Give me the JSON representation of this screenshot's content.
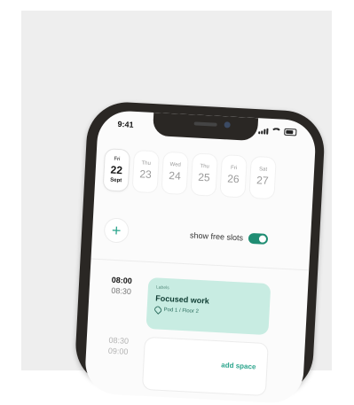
{
  "status": {
    "time": "9:41"
  },
  "days": [
    {
      "dow": "Fri",
      "num": "22",
      "mon": "Sept",
      "selected": true
    },
    {
      "dow": "Thu",
      "num": "23",
      "mon": "",
      "selected": false
    },
    {
      "dow": "Wed",
      "num": "24",
      "mon": "",
      "selected": false
    },
    {
      "dow": "Thu",
      "num": "25",
      "mon": "",
      "selected": false
    },
    {
      "dow": "Fri",
      "num": "26",
      "mon": "",
      "selected": false
    },
    {
      "dow": "Sat",
      "num": "27",
      "mon": "",
      "selected": false
    }
  ],
  "controls": {
    "add_symbol": "+",
    "free_slots_label": "show free slots",
    "free_slots_on": true
  },
  "slots": [
    {
      "start": "08:00",
      "end": "08:30",
      "active": true,
      "booking": {
        "tag": "Labels",
        "title": "Focused work",
        "place": "Pod 1 / Floor 2"
      }
    },
    {
      "start": "08:30",
      "end": "09:00",
      "active": false,
      "action": "add space"
    }
  ],
  "colors": {
    "accent": "#2ca58d",
    "booking_bg": "#c8ece2",
    "toggle": "#1f8d73",
    "phone": "#2a2724"
  }
}
